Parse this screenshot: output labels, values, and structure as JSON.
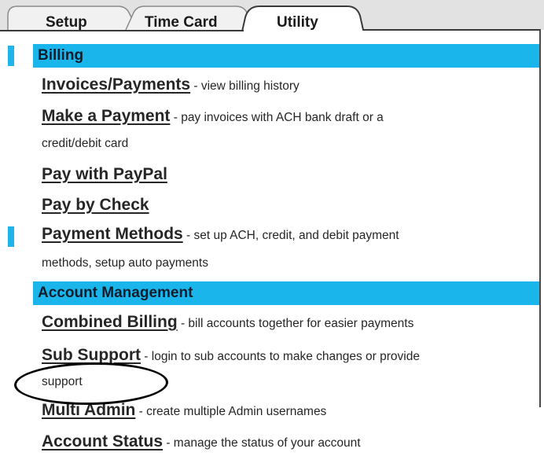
{
  "tabs": [
    {
      "label": "Setup",
      "active": false
    },
    {
      "label": "Time Card",
      "active": false
    },
    {
      "label": "Utility",
      "active": true
    }
  ],
  "sections": [
    {
      "header": "Billing",
      "items": [
        {
          "link": "Invoices/Payments",
          "desc": " - view billing history"
        },
        {
          "link": "Make a Payment",
          "desc": " - pay invoices with ACH bank draft or a",
          "desc_line2": "credit/debit card"
        },
        {
          "link": "Pay with PayPal",
          "desc": ""
        },
        {
          "link": "Pay by Check",
          "desc": ""
        },
        {
          "link": "Payment Methods",
          "desc": " - set up ACH, credit, and debit payment",
          "desc_line2": "methods, setup auto payments"
        }
      ]
    },
    {
      "header": "Account Management",
      "items": [
        {
          "link": "Combined Billing",
          "desc": " - bill accounts together for easier payments"
        },
        {
          "link": "Sub Support",
          "desc": " - login to sub accounts to make changes or provide",
          "desc_line2": "support"
        },
        {
          "link": "Multi Admin",
          "desc": " - create multiple Admin usernames"
        },
        {
          "link": "Account Status",
          "desc": " - manage the status of your account"
        }
      ]
    }
  ],
  "colors": {
    "section_header_bg": "#19b5eb",
    "tab_bar_bg": "#e2e2e2",
    "highlight_circle": "#000000"
  }
}
